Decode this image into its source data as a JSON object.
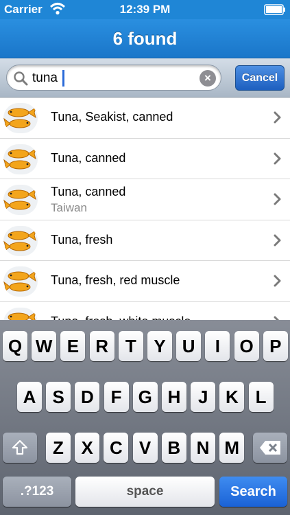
{
  "status_bar": {
    "carrier": "Carrier",
    "time": "12:39 PM"
  },
  "nav": {
    "title": "6 found"
  },
  "search": {
    "value": "tuna",
    "cancel_label": "Cancel"
  },
  "results": [
    {
      "title": "Tuna, Seakist, canned",
      "subtitle": ""
    },
    {
      "title": "Tuna, canned",
      "subtitle": ""
    },
    {
      "title": "Tuna, canned",
      "subtitle": "Taiwan"
    },
    {
      "title": "Tuna, fresh",
      "subtitle": ""
    },
    {
      "title": "Tuna, fresh, red muscle",
      "subtitle": ""
    },
    {
      "title": "Tuna, fresh, white muscle",
      "subtitle": ""
    }
  ],
  "keyboard": {
    "row1": [
      "Q",
      "W",
      "E",
      "R",
      "T",
      "Y",
      "U",
      "I",
      "O",
      "P"
    ],
    "row2": [
      "A",
      "S",
      "D",
      "F",
      "G",
      "H",
      "J",
      "K",
      "L"
    ],
    "row3": [
      "Z",
      "X",
      "C",
      "V",
      "B",
      "N",
      "M"
    ],
    "mode_label": ".?123",
    "space_label": "space",
    "search_label": "Search"
  },
  "icons": {
    "wifi": "wifi-icon",
    "battery": "battery-icon",
    "search": "search-icon",
    "clear": "clear-icon",
    "chevron": "chevron-right-icon",
    "fish": "fish-icon",
    "shift": "shift-icon",
    "delete": "delete-icon"
  },
  "colors": {
    "nav_blue": "#1a76c9",
    "search_key": "#1a62d6",
    "caret": "#2a6ad8"
  }
}
